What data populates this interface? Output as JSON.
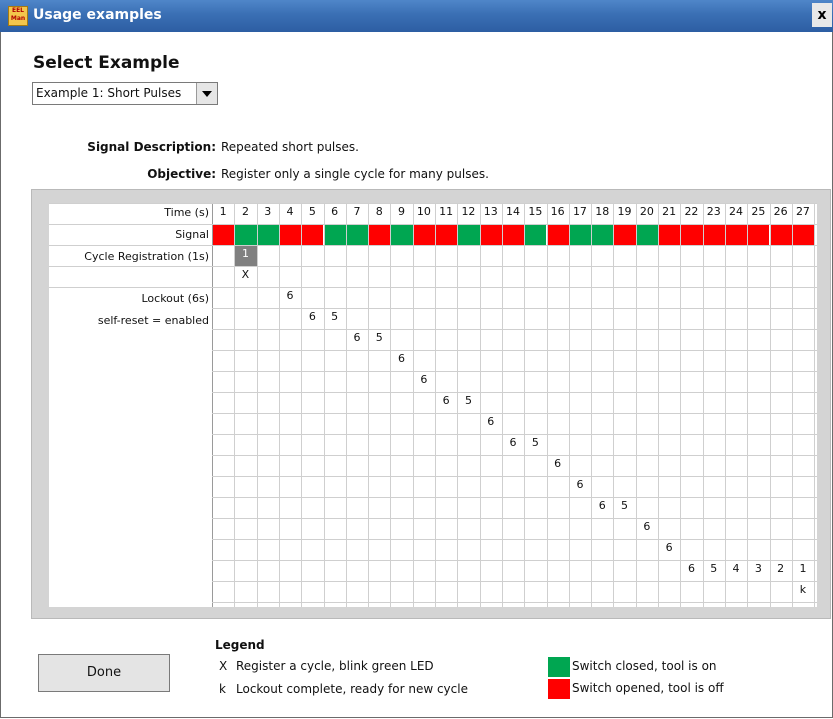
{
  "window": {
    "title": "Usage examples",
    "icon_text": "EEL Man",
    "close": "x"
  },
  "heading": "Select Example",
  "example_select": {
    "value": "Example 1: Short Pulses"
  },
  "signal_description": {
    "label": "Signal Description:",
    "value": "Repeated short pulses."
  },
  "objective": {
    "label": "Objective:",
    "value": "Register only a single cycle for many pulses."
  },
  "timeline": {
    "time_label": "Time (s)",
    "signal_label": "Signal",
    "cycle_label": "Cycle Registration (1s)",
    "lockout_label": "Lockout (6s)",
    "selfreset_label": "self-reset = enabled",
    "times": [
      "1",
      "2",
      "3",
      "4",
      "5",
      "6",
      "7",
      "8",
      "9",
      "10",
      "11",
      "12",
      "13",
      "14",
      "15",
      "16",
      "17",
      "18",
      "19",
      "20",
      "21",
      "22",
      "23",
      "24",
      "25",
      "26",
      "27"
    ],
    "signal_states": [
      "off",
      "on",
      "on",
      "off",
      "off",
      "on",
      "on",
      "off",
      "on",
      "off",
      "off",
      "on",
      "off",
      "off",
      "on",
      "off",
      "on",
      "on",
      "off",
      "on",
      "off",
      "off",
      "off",
      "off",
      "off",
      "off",
      "off"
    ],
    "cycle_value": "1",
    "cycle_marker": "X",
    "lockout_entries": [
      {
        "row": 0,
        "col": 3,
        "text": "6"
      },
      {
        "row": 1,
        "col": 4,
        "text": "6"
      },
      {
        "row": 1,
        "col": 5,
        "text": "5"
      },
      {
        "row": 2,
        "col": 6,
        "text": "6"
      },
      {
        "row": 2,
        "col": 7,
        "text": "5"
      },
      {
        "row": 3,
        "col": 8,
        "text": "6"
      },
      {
        "row": 4,
        "col": 9,
        "text": "6"
      },
      {
        "row": 5,
        "col": 10,
        "text": "6"
      },
      {
        "row": 5,
        "col": 11,
        "text": "5"
      },
      {
        "row": 6,
        "col": 12,
        "text": "6"
      },
      {
        "row": 7,
        "col": 13,
        "text": "6"
      },
      {
        "row": 7,
        "col": 14,
        "text": "5"
      },
      {
        "row": 8,
        "col": 15,
        "text": "6"
      },
      {
        "row": 9,
        "col": 16,
        "text": "6"
      },
      {
        "row": 10,
        "col": 17,
        "text": "6"
      },
      {
        "row": 10,
        "col": 18,
        "text": "5"
      },
      {
        "row": 11,
        "col": 19,
        "text": "6"
      },
      {
        "row": 12,
        "col": 20,
        "text": "6"
      },
      {
        "row": 13,
        "col": 21,
        "text": "6"
      },
      {
        "row": 13,
        "col": 22,
        "text": "5"
      },
      {
        "row": 13,
        "col": 23,
        "text": "4"
      },
      {
        "row": 13,
        "col": 24,
        "text": "3"
      },
      {
        "row": 13,
        "col": 25,
        "text": "2"
      },
      {
        "row": 13,
        "col": 26,
        "text": "1"
      },
      {
        "row": 14,
        "col": 26,
        "text": "k"
      }
    ]
  },
  "done_button": "Done",
  "legend": {
    "title": "Legend",
    "items": [
      {
        "key": "X",
        "text": "Register a cycle, blink green LED"
      },
      {
        "key": "k",
        "text": "Lockout complete, ready for new cycle"
      }
    ],
    "colors": [
      {
        "text": "Switch closed, tool is on",
        "color": "#00a651"
      },
      {
        "text": "Switch opened, tool is off",
        "color": "#ff0000"
      }
    ]
  },
  "colors": {
    "on": "#00a651",
    "off": "#ff0000",
    "cycle_cell": "#808080",
    "titlebar": "#3a6fb4"
  }
}
